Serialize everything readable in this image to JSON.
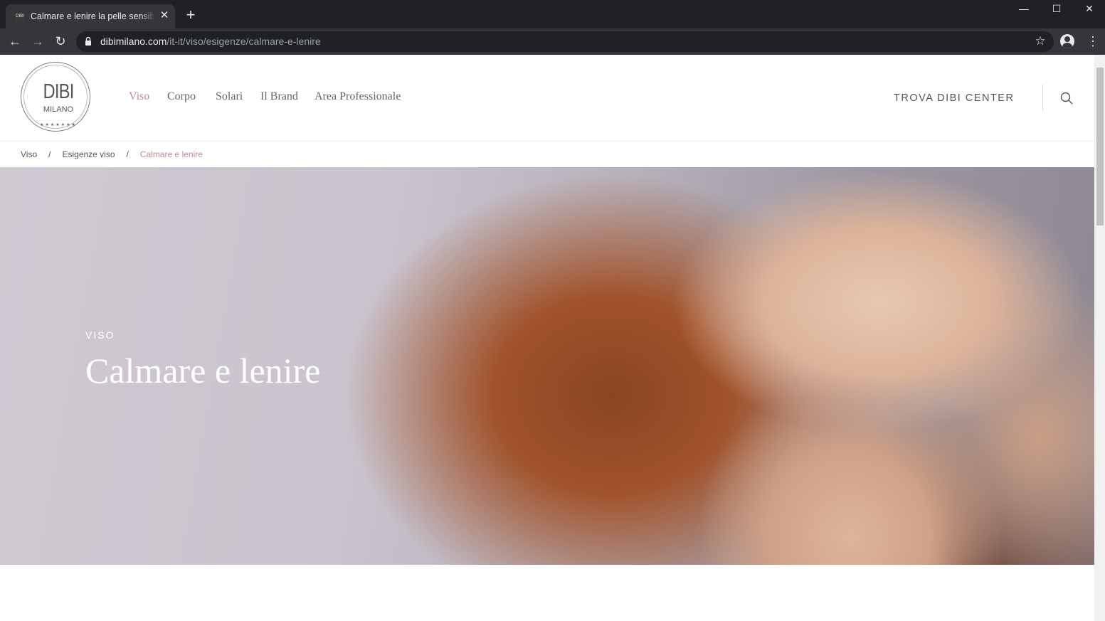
{
  "browser": {
    "tab_title": "Calmare e lenire la pelle sensibile",
    "tab_favicon_text": "DIBI",
    "url_host": "dibimilano.com",
    "url_path": "/it-it/viso/esigenze/calmare-e-lenire"
  },
  "header": {
    "logo": {
      "main": "DIBI",
      "sub": "MILANO",
      "stars": "★★★★★★★"
    },
    "nav": [
      "Viso",
      "Corpo",
      "Solari",
      "Il Brand",
      "Area Professionale"
    ],
    "active_nav": "Viso",
    "cta_label": "TROVA DIBI CENTER"
  },
  "breadcrumb": {
    "items": [
      "Viso",
      "Esigenze viso",
      "Calmare e lenire"
    ],
    "separator": "/"
  },
  "hero": {
    "label": "VISO",
    "title": "Calmare e lenire"
  },
  "colors": {
    "accent": "#c48a8f",
    "chrome_dark": "#202124",
    "chrome_tab": "#35363a"
  }
}
